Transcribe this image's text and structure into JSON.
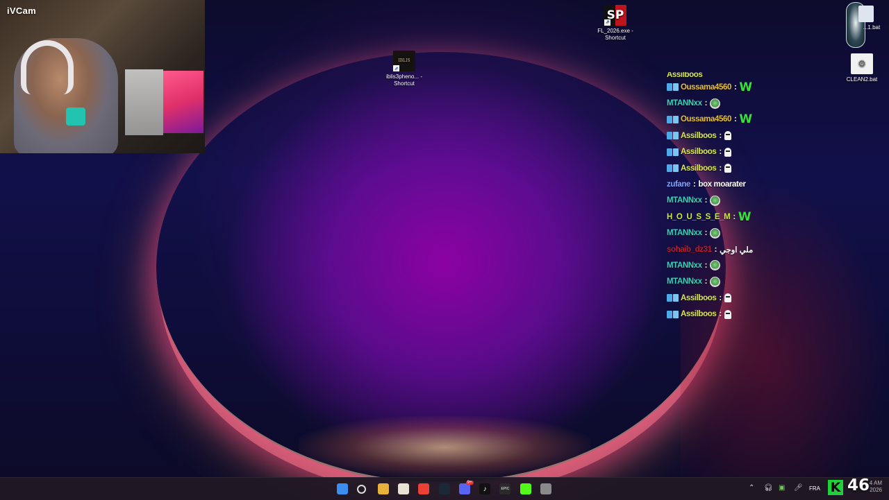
{
  "webcam": {
    "label": "iVCam"
  },
  "desktop_icons": {
    "fl": {
      "icon_text": "SP",
      "label": "FL_2026.exe - Shortcut"
    },
    "iblis": {
      "icon_text": "IBLIS",
      "label": "iblis3pheno... - Shortcut"
    },
    "partial_bat": {
      "label": "...1.bat"
    },
    "clean2": {
      "label": "CLEAN2.bat"
    }
  },
  "chat": {
    "partial_top": {
      "user": "Assilboos",
      "user_color": "#d8e84a"
    },
    "messages": [
      {
        "user": "Oussama4560",
        "color": "#e8c02a",
        "badge": true,
        "type": "w",
        "text": "W"
      },
      {
        "user": "MTANNxx",
        "color": "#36d3b8",
        "badge": false,
        "type": "alien",
        "text": ""
      },
      {
        "user": "Oussama4560",
        "color": "#e8c02a",
        "badge": true,
        "type": "w",
        "text": "W"
      },
      {
        "user": "Assilboos",
        "color": "#d8e84a",
        "badge": true,
        "type": "ghost",
        "text": ""
      },
      {
        "user": "Assilboos",
        "color": "#d8e84a",
        "badge": true,
        "type": "ghost",
        "text": ""
      },
      {
        "user": "Assilboos",
        "color": "#d8e84a",
        "badge": true,
        "type": "ghost",
        "text": ""
      },
      {
        "user": "zufane",
        "color": "#7fa4ff",
        "badge": false,
        "type": "text",
        "text": "box moarater"
      },
      {
        "user": "MTANNxx",
        "color": "#36d3b8",
        "badge": false,
        "type": "alien",
        "text": ""
      },
      {
        "user": "H_O_U_S_S_E_M",
        "color": "#c8ec32",
        "badge": false,
        "type": "w",
        "text": "W"
      },
      {
        "user": "MTANNxx",
        "color": "#36d3b8",
        "badge": false,
        "type": "alien",
        "text": ""
      },
      {
        "user": "sohaib_dz31",
        "color": "#c2182a",
        "badge": false,
        "type": "text",
        "text": "ملي اوجي"
      },
      {
        "user": "MTANNxx",
        "color": "#36d3b8",
        "badge": false,
        "type": "alien",
        "text": ""
      },
      {
        "user": "MTANNxx",
        "color": "#36d3b8",
        "badge": false,
        "type": "alien",
        "text": ""
      },
      {
        "user": "Assilboos",
        "color": "#d8e84a",
        "badge": true,
        "type": "ghost",
        "text": ""
      },
      {
        "user": "Assilboos",
        "color": "#d8e84a",
        "badge": true,
        "type": "ghost",
        "text": ""
      }
    ]
  },
  "taskbar": {
    "apps": [
      {
        "name": "start-icon",
        "color": "#3a8ef0",
        "glyph": ""
      },
      {
        "name": "search-icon",
        "color": "transparent",
        "glyph": ""
      },
      {
        "name": "file-explorer-icon",
        "color": "#e8b23a",
        "glyph": ""
      },
      {
        "name": "store-icon",
        "color": "#e8e2d2",
        "glyph": ""
      },
      {
        "name": "chrome-icon",
        "color": "#e94235",
        "glyph": ""
      },
      {
        "name": "steam-icon",
        "color": "#1b2838",
        "glyph": ""
      },
      {
        "name": "discord-icon",
        "color": "#5865f2",
        "glyph": ""
      },
      {
        "name": "tiktok-icon",
        "color": "#111111",
        "glyph": "♪"
      },
      {
        "name": "epic-games-icon",
        "color": "#2a2a2a",
        "glyph": "EPIC"
      },
      {
        "name": "kick-app-icon",
        "color": "#53fc18",
        "glyph": ""
      },
      {
        "name": "stream-app-icon",
        "color": "#8a8a8a",
        "glyph": ""
      }
    ],
    "discord_badge": "9+",
    "language": "FRA",
    "viewer_count": "46",
    "clock_time": "4 AM",
    "clock_date": "2026"
  }
}
